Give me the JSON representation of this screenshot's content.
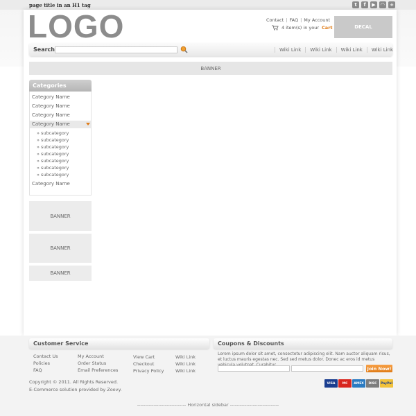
{
  "top_bar": {
    "h1_text": "page title in an H1 tag",
    "social_icons": [
      "twitter-icon",
      "facebook-icon",
      "youtube-icon",
      "rss-icon",
      "share-icon"
    ]
  },
  "header": {
    "logo": "LOGO",
    "links": [
      "Contact",
      "FAQ",
      "My Account"
    ],
    "cart_prefix": "4 item(s) in your",
    "cart_word": "Cart",
    "decal": "DECAL"
  },
  "search": {
    "label": "Search",
    "placeholder": "",
    "nav": [
      "Wiki Link",
      "Wiki Link",
      "Wiki Link",
      "Wiki Link"
    ]
  },
  "banner": "BANNER",
  "categories": {
    "title": "Categories",
    "items": [
      "Category Name",
      "Category Name",
      "Category Name",
      "Category Name"
    ],
    "subcategories": [
      "» subcategory",
      "» subcategory",
      "» subcategory",
      "» subcategory",
      "» subcategory",
      "» subcategory",
      "» subcategory"
    ],
    "last_item": "Category Name"
  },
  "side_banners": [
    "BANNER",
    "BANNER",
    "BANNER"
  ],
  "footer": {
    "customer_service_title": "Customer Service",
    "col1": [
      "Contact Us",
      "Policies",
      "FAQ"
    ],
    "col2": [
      "My Account",
      "Order Status",
      "Email Preferences"
    ],
    "col3": [
      "View Cart",
      "Checkout",
      "Privacy Policy"
    ],
    "col4": [
      "Wiki Link",
      "Wiki Link",
      "Wiki Link"
    ],
    "coupons_title": "Coupons & Discounts",
    "coupons_text": "Lorem ipsum dolor sit amet, consectetur adipiscing elit. Nam auctor aliquam risus, et luctus mauris egestas nec. Sed sed metus dolor. Donec ac eros id metus vehicula volutpat. Curabitur",
    "join_label": "Join Now!",
    "copyright": "Copyright © 2011. All Rights Reserved.",
    "powered": "E-Commerce solution provided by Zoovy.",
    "cards": [
      "VISA",
      "MC",
      "AMEX",
      "DISC",
      "PayPal"
    ],
    "horizontal_sidebar": "------------------------------ Horizontal sidebar ------------------------------"
  },
  "colors": {
    "accent": "#e07c18",
    "logo": "#8c8c8c",
    "decal": "#c9c9c9"
  }
}
